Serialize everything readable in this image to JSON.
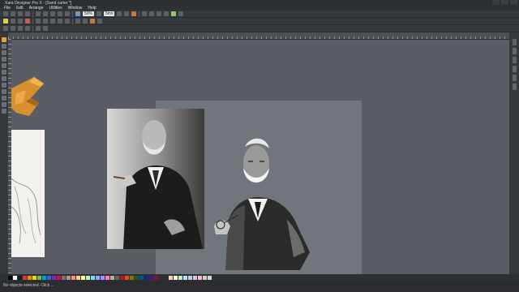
{
  "window": {
    "title": "Xara Designer Pro X - [Sand carter *]"
  },
  "menu": [
    "File",
    "Edit",
    "Arrange",
    "Utilities",
    "Window",
    "Help"
  ],
  "toolbar": {
    "zoom_value": "50%",
    "size_value": "5ms"
  },
  "status": {
    "text": "No objects selected. Click ..."
  },
  "palette": [
    "#000000",
    "#ffffff",
    "#1a1a1a",
    "#e03c31",
    "#f08c00",
    "#f2d600",
    "#6cc04a",
    "#00a3e0",
    "#3b5bdb",
    "#7b2cbf",
    "#c2185b",
    "#8d6e63",
    "#9e9e9e",
    "#ff8a80",
    "#ffd180",
    "#ffff8d",
    "#b9f6ca",
    "#80d8ff",
    "#82b1ff",
    "#b388ff",
    "#ff80ab",
    "#bcaaa4",
    "#616161",
    "#b71c1c",
    "#e65100",
    "#827717",
    "#1b5e20",
    "#01579b",
    "#1a237e",
    "#4a148c",
    "#880e4f",
    "#3e2723",
    "#263238",
    "#ffccbc",
    "#fff9c4",
    "#c8e6c9",
    "#b3e5fc",
    "#c5cae9",
    "#e1bee7",
    "#f8bbd0",
    "#d7ccc8",
    "#cfd8dc"
  ]
}
